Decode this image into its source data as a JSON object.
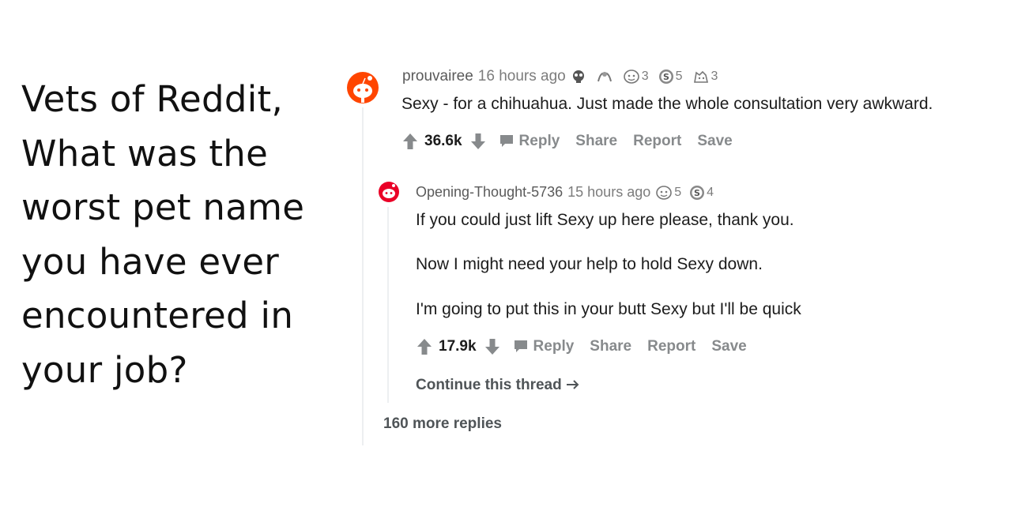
{
  "question": {
    "lines": [
      "Vets of Reddit,",
      "What was the",
      "worst pet name",
      "you have ever",
      "encountered in",
      "your job?"
    ]
  },
  "comment1": {
    "username": "prouvairee",
    "time": "16 hours ago",
    "awards": [
      {
        "icon": "skull-award-icon",
        "count": ""
      },
      {
        "icon": "hands-award-icon",
        "count": ""
      },
      {
        "icon": "helpful-award-icon",
        "count": "3"
      },
      {
        "icon": "silver-award-icon",
        "count": "5"
      },
      {
        "icon": "wholesome-award-icon",
        "count": "3"
      }
    ],
    "text": "Sexy - for a chihuahua. Just made the whole consultation very awkward.",
    "score": "36.6k",
    "actions": {
      "reply": "Reply",
      "share": "Share",
      "report": "Report",
      "save": "Save"
    }
  },
  "comment2": {
    "username": "Opening-Thought-5736",
    "time": "15 hours ago",
    "awards": [
      {
        "icon": "helpful-award-icon",
        "count": "5"
      },
      {
        "icon": "silver-award-icon",
        "count": "4"
      }
    ],
    "paragraphs": [
      "If you could just lift Sexy up here please, thank you.",
      "Now I might need your help to hold Sexy down.",
      "I'm going to put this in your butt Sexy but I'll be quick"
    ],
    "score": "17.9k",
    "actions": {
      "reply": "Reply",
      "share": "Share",
      "report": "Report",
      "save": "Save"
    }
  },
  "continue_thread": "Continue this thread",
  "more_replies": "160 more replies",
  "colors": {
    "snoo_orange": "#ff4500",
    "snoo_pink": "#ea0027",
    "muted": "#878a8c",
    "line": "#edeff1"
  }
}
